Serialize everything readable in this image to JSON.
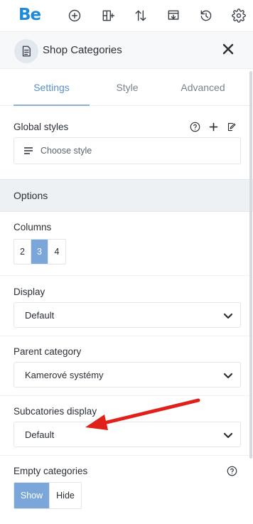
{
  "toolbar": {
    "logo": "Be",
    "icons": [
      "add-icon",
      "layout-icon",
      "sort-icon",
      "import-icon",
      "history-icon",
      "settings-icon"
    ]
  },
  "panel": {
    "title": "Shop Categories",
    "icon": "document-icon",
    "close_icon": "close-icon"
  },
  "tabs": [
    {
      "label": "Settings",
      "active": true
    },
    {
      "label": "Style",
      "active": false
    },
    {
      "label": "Advanced",
      "active": false
    }
  ],
  "global_styles": {
    "label": "Global styles",
    "placeholder": "Choose style",
    "icons": [
      "help-icon",
      "plus-icon",
      "edit-style-icon"
    ]
  },
  "options": {
    "heading": "Options",
    "columns": {
      "label": "Columns",
      "options": [
        "2",
        "3",
        "4"
      ],
      "selected": "3"
    },
    "display": {
      "label": "Display",
      "value": "Default"
    },
    "parent_category": {
      "label": "Parent category",
      "value": "Kamerové systémy"
    },
    "subcategories_display": {
      "label": "Subcatories display",
      "value": "Default"
    },
    "empty_categories": {
      "label": "Empty categories",
      "options": [
        "Show",
        "Hide"
      ],
      "selected": "Show"
    }
  },
  "colors": {
    "accent": "#7aa6d9",
    "tab_active": "#5a8fc9",
    "logo": "#1f8bd8",
    "annotation_arrow": "#e0201b"
  }
}
